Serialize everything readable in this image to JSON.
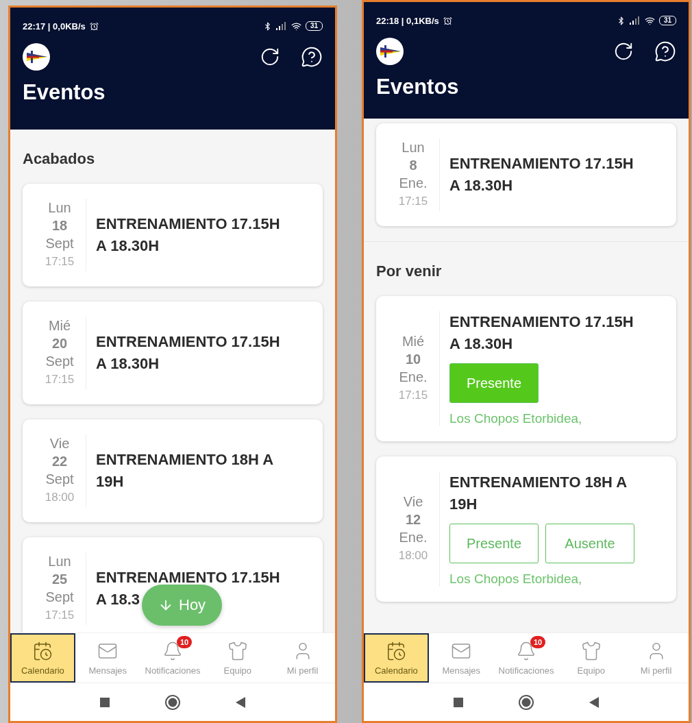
{
  "phones": [
    {
      "status": {
        "time": "22:17 | 0,0KB/s",
        "battery": "31"
      },
      "title": "Eventos",
      "sections": [
        {
          "heading": "Acabados",
          "events": [
            {
              "day": "Lun",
              "date": "18",
              "month": "Sept",
              "time": "17:15",
              "title": [
                "ENTRENAMIENTO 17.15H",
                "A 18.30H"
              ]
            },
            {
              "day": "Mié",
              "date": "20",
              "month": "Sept",
              "time": "17:15",
              "title": [
                "ENTRENAMIENTO 17.15H",
                "A 18.30H"
              ]
            },
            {
              "day": "Vie",
              "date": "22",
              "month": "Sept",
              "time": "18:00",
              "title": [
                "ENTRENAMIENTO 18H A",
                "19H"
              ]
            },
            {
              "day": "Lun",
              "date": "25",
              "month": "Sept",
              "time": "17:15",
              "title": [
                "ENTRENAMIENTO 17.15H",
                "A 18.3"
              ]
            }
          ]
        }
      ],
      "fab": {
        "label": "Hoy"
      },
      "nav": [
        {
          "kind": "calendar",
          "label": "Calendario",
          "selected": true
        },
        {
          "kind": "mail",
          "label": "Mensajes",
          "selected": false
        },
        {
          "kind": "bell",
          "label": "Notificaciones",
          "selected": false,
          "badge": "10"
        },
        {
          "kind": "shirt",
          "label": "Equipo",
          "selected": false
        },
        {
          "kind": "user",
          "label": "Mi perfil",
          "selected": false
        }
      ]
    },
    {
      "status": {
        "time": "22:18 | 0,1KB/s",
        "battery": "31"
      },
      "title": "Eventos",
      "sections": [
        {
          "events": [
            {
              "day": "Lun",
              "date": "8",
              "month": "Ene.",
              "time": "17:15",
              "title": [
                "ENTRENAMIENTO 17.15H",
                "A 18.30H"
              ]
            }
          ]
        },
        {
          "heading": "Por venir",
          "events": [
            {
              "day": "Mié",
              "date": "10",
              "month": "Ene.",
              "time": "17:15",
              "title": [
                "ENTRENAMIENTO 17.15H",
                "A 18.30H"
              ],
              "actions": [
                {
                  "label": "Presente",
                  "selected": true
                }
              ],
              "location": "Los Chopos Etorbidea,"
            },
            {
              "day": "Vie",
              "date": "12",
              "month": "Ene.",
              "time": "18:00",
              "title": [
                "ENTRENAMIENTO 18H A",
                "19H"
              ],
              "actions": [
                {
                  "label": "Presente",
                  "selected": false
                },
                {
                  "label": "Ausente",
                  "selected": false
                }
              ],
              "location": "Los Chopos Etorbidea,"
            }
          ]
        }
      ],
      "nav": [
        {
          "kind": "calendar",
          "label": "Calendario",
          "selected": true
        },
        {
          "kind": "mail",
          "label": "Mensajes",
          "selected": false
        },
        {
          "kind": "bell",
          "label": "Notificaciones",
          "selected": false,
          "badge": "10"
        },
        {
          "kind": "shirt",
          "label": "Equipo",
          "selected": false
        },
        {
          "kind": "user",
          "label": "Mi perfil",
          "selected": false
        }
      ]
    }
  ]
}
